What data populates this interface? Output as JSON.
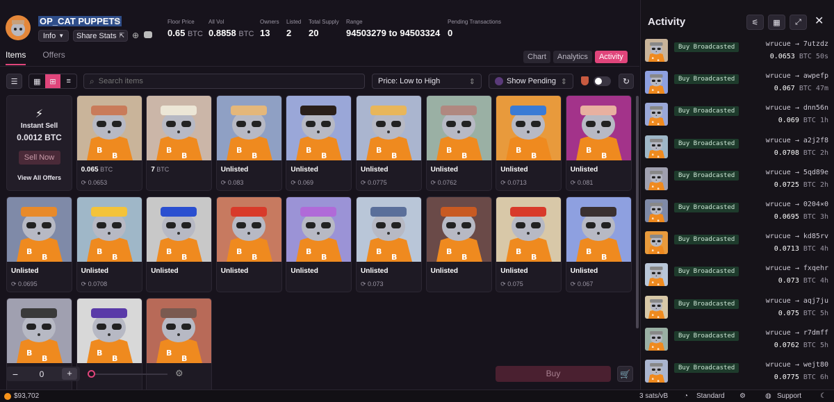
{
  "collection": {
    "name": "OP_CAT PUPPETS",
    "info_label": "Info",
    "share_label": "Share Stats"
  },
  "stats": [
    {
      "label": "Floor Price",
      "value": "0.65",
      "unit": "BTC"
    },
    {
      "label": "All Vol",
      "value": "0.8858",
      "unit": "BTC"
    },
    {
      "label": "Owners",
      "value": "13",
      "unit": ""
    },
    {
      "label": "Listed",
      "value": "2",
      "unit": ""
    },
    {
      "label": "Total Supply",
      "value": "20",
      "unit": ""
    },
    {
      "label": "Range",
      "value": "94503279 to 94503324",
      "unit": ""
    },
    {
      "label": "Pending Transactions",
      "value": "0",
      "unit": ""
    }
  ],
  "tabs": [
    "Items",
    "Offers"
  ],
  "view_tabs": [
    "Chart",
    "Analytics",
    "Activity"
  ],
  "search": {
    "placeholder": "Search items"
  },
  "sort": {
    "selected": "Price: Low to High"
  },
  "pending": {
    "selected": "Show Pending"
  },
  "instant_sell": {
    "title": "Instant Sell",
    "price": "0.0012 BTC",
    "button": "Sell Now",
    "link": "View All Offers"
  },
  "items": [
    {
      "status": "0.065",
      "unit": "BTC",
      "listed": true,
      "last": "0.0653",
      "bg": "#c9b49a",
      "hat": "#c97b5a"
    },
    {
      "status": "7",
      "unit": "BTC",
      "listed": true,
      "last": "",
      "bg": "#cbb6a8",
      "hat": "#ece6d6"
    },
    {
      "status": "Unlisted",
      "unit": "",
      "listed": false,
      "last": "0.083",
      "bg": "#8fa0c4",
      "hat": "#e4b77a"
    },
    {
      "status": "Unlisted",
      "unit": "",
      "listed": false,
      "last": "0.069",
      "bg": "#9aa7d8",
      "hat": "#2a1f1a"
    },
    {
      "status": "Unlisted",
      "unit": "",
      "listed": false,
      "last": "0.0775",
      "bg": "#aab5cf",
      "hat": "#e8b65a"
    },
    {
      "status": "Unlisted",
      "unit": "",
      "listed": false,
      "last": "0.0762",
      "bg": "#9ab0a4",
      "hat": "#b08880"
    },
    {
      "status": "Unlisted",
      "unit": "",
      "listed": false,
      "last": "0.0713",
      "bg": "#e89a3c",
      "hat": "#3a7bd5"
    },
    {
      "status": "Unlisted",
      "unit": "",
      "listed": false,
      "last": "0.081",
      "bg": "#a3338a",
      "hat": "#e8b0a0"
    },
    {
      "status": "Unlisted",
      "unit": "",
      "listed": false,
      "last": "0.0695",
      "bg": "#7f8aa8",
      "hat": "#e88a2a"
    },
    {
      "status": "Unlisted",
      "unit": "",
      "listed": false,
      "last": "0.0708",
      "bg": "#9fb7c8",
      "hat": "#f3c33a"
    },
    {
      "status": "Unlisted",
      "unit": "",
      "listed": false,
      "last": "",
      "bg": "#c8c8c8",
      "hat": "#2a4fd0"
    },
    {
      "status": "Unlisted",
      "unit": "",
      "listed": false,
      "last": "",
      "bg": "#c77a60",
      "hat": "#d83a2a"
    },
    {
      "status": "Unlisted",
      "unit": "",
      "listed": false,
      "last": "",
      "bg": "#9b93d6",
      "hat": "#b06ad8"
    },
    {
      "status": "Unlisted",
      "unit": "",
      "listed": false,
      "last": "0.073",
      "bg": "#b9c6d8",
      "hat": "#5a6f9a"
    },
    {
      "status": "Unlisted",
      "unit": "",
      "listed": false,
      "last": "",
      "bg": "#6a4a48",
      "hat": "#c85a22"
    },
    {
      "status": "Unlisted",
      "unit": "",
      "listed": false,
      "last": "0.075",
      "bg": "#d8c8a8",
      "hat": "#d83a2a"
    },
    {
      "status": "Unlisted",
      "unit": "",
      "listed": false,
      "last": "0.067",
      "bg": "#8ea0e0",
      "hat": "#3a3030"
    },
    {
      "status": "",
      "unit": "",
      "listed": false,
      "last": "",
      "bg": "#a0a0b0",
      "hat": "#3a3a3a"
    },
    {
      "status": "",
      "unit": "",
      "listed": false,
      "last": "",
      "bg": "#d8d8d8",
      "hat": "#5a3aa8"
    },
    {
      "status": "",
      "unit": "",
      "listed": false,
      "last": "",
      "bg": "#b86a58",
      "hat": "#7a5a50"
    }
  ],
  "cart": {
    "qty": "0",
    "buy_label": "Buy"
  },
  "activity": {
    "title": "Activity",
    "entries": [
      {
        "badge": "Buy Broadcasted",
        "from": "wrucue",
        "to": "7utzdz",
        "amount": "0.0653",
        "unit": "BTC",
        "age": "50s",
        "bg": "#c9b49a"
      },
      {
        "badge": "Buy Broadcasted",
        "from": "wrucue",
        "to": "awpefp",
        "amount": "0.067",
        "unit": "BTC",
        "age": "47m",
        "bg": "#8ea0e0"
      },
      {
        "badge": "Buy Broadcasted",
        "from": "wrucue",
        "to": "dnn56n",
        "amount": "0.069",
        "unit": "BTC",
        "age": "1h",
        "bg": "#9aa7d8"
      },
      {
        "badge": "Buy Broadcasted",
        "from": "wrucue",
        "to": "a2j2f8",
        "amount": "0.0708",
        "unit": "BTC",
        "age": "2h",
        "bg": "#9fb7c8"
      },
      {
        "badge": "Buy Broadcasted",
        "from": "wrucue",
        "to": "5qd89e",
        "amount": "0.0725",
        "unit": "BTC",
        "age": "2h",
        "bg": "#a0a0b0"
      },
      {
        "badge": "Buy Broadcasted",
        "from": "wrucue",
        "to": "0204×0",
        "amount": "0.0695",
        "unit": "BTC",
        "age": "3h",
        "bg": "#7f8aa8"
      },
      {
        "badge": "Buy Broadcasted",
        "from": "wrucue",
        "to": "kd85rv",
        "amount": "0.0713",
        "unit": "BTC",
        "age": "4h",
        "bg": "#e89a3c"
      },
      {
        "badge": "Buy Broadcasted",
        "from": "wrucue",
        "to": "fxqehr",
        "amount": "0.073",
        "unit": "BTC",
        "age": "4h",
        "bg": "#b9c6d8"
      },
      {
        "badge": "Buy Broadcasted",
        "from": "wrucue",
        "to": "aqj7ju",
        "amount": "0.075",
        "unit": "BTC",
        "age": "5h",
        "bg": "#d8c8a8"
      },
      {
        "badge": "Buy Broadcasted",
        "from": "wrucue",
        "to": "r7dmff",
        "amount": "0.0762",
        "unit": "BTC",
        "age": "5h",
        "bg": "#9ab0a4"
      },
      {
        "badge": "Buy Broadcasted",
        "from": "wrucue",
        "to": "wejt80",
        "amount": "0.0775",
        "unit": "BTC",
        "age": "6h",
        "bg": "#aab5cf"
      }
    ]
  },
  "footer": {
    "btc_price": "$93,702",
    "fee": "3 sats/vB",
    "fee_mode": "Standard",
    "support": "Support"
  }
}
